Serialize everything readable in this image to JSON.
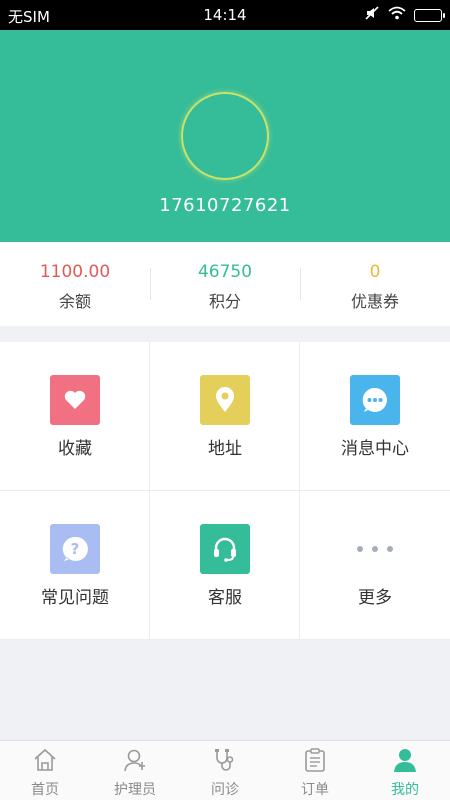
{
  "status_bar": {
    "carrier": "无SIM",
    "time": "14:14"
  },
  "profile": {
    "phone": "17610727621"
  },
  "stats": [
    {
      "value": "1100.00",
      "label": "余额",
      "color": "#e05a5a"
    },
    {
      "value": "46750",
      "label": "积分",
      "color": "#35bc98"
    },
    {
      "value": "0",
      "label": "优惠券",
      "color": "#e8b83a"
    }
  ],
  "menu": [
    {
      "label": "收藏",
      "icon": "heart-icon",
      "color": "#f17183"
    },
    {
      "label": "地址",
      "icon": "location-pin-icon",
      "color": "#e3cf5a"
    },
    {
      "label": "消息中心",
      "icon": "message-icon",
      "color": "#4ab4ec"
    },
    {
      "label": "常见问题",
      "icon": "question-icon",
      "color": "#a9bdf2"
    },
    {
      "label": "客服",
      "icon": "headset-icon",
      "color": "#35bc98"
    },
    {
      "label": "更多",
      "icon": "more-dots-icon",
      "color": "#a5aebb"
    }
  ],
  "tabbar": [
    {
      "label": "首页",
      "icon": "home-icon",
      "active": false
    },
    {
      "label": "护理员",
      "icon": "nurse-icon",
      "active": false
    },
    {
      "label": "问诊",
      "icon": "consult-icon",
      "active": false
    },
    {
      "label": "订单",
      "icon": "order-icon",
      "active": false
    },
    {
      "label": "我的",
      "icon": "profile-icon",
      "active": true
    }
  ]
}
